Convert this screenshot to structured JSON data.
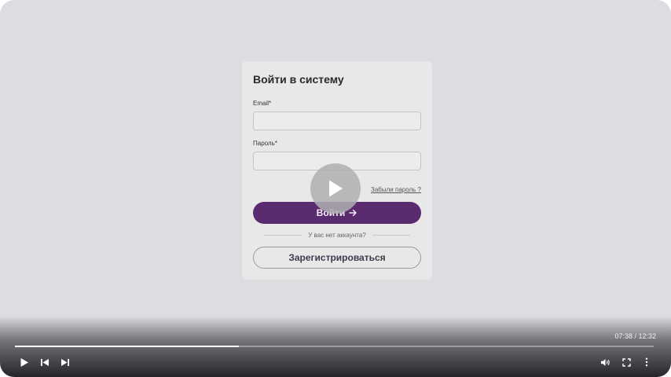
{
  "login_form": {
    "title": "Войти в систему",
    "email_label": "Email*",
    "email_value": "",
    "password_label": "Пароль*",
    "password_value": "",
    "forgot_password": "Забыли пароль ?",
    "login_button": "Войти",
    "no_account_text": "У вас нет аккаунта?",
    "register_button": "Зарегистрироваться",
    "accent_color": "#5b2b70"
  },
  "video_player": {
    "time_display": "07:38 / 12:32",
    "progress": 0.35,
    "controls": [
      "play-icon",
      "previous-icon",
      "next-icon",
      "volume-icon",
      "fullscreen-icon",
      "more-options-icon"
    ]
  }
}
